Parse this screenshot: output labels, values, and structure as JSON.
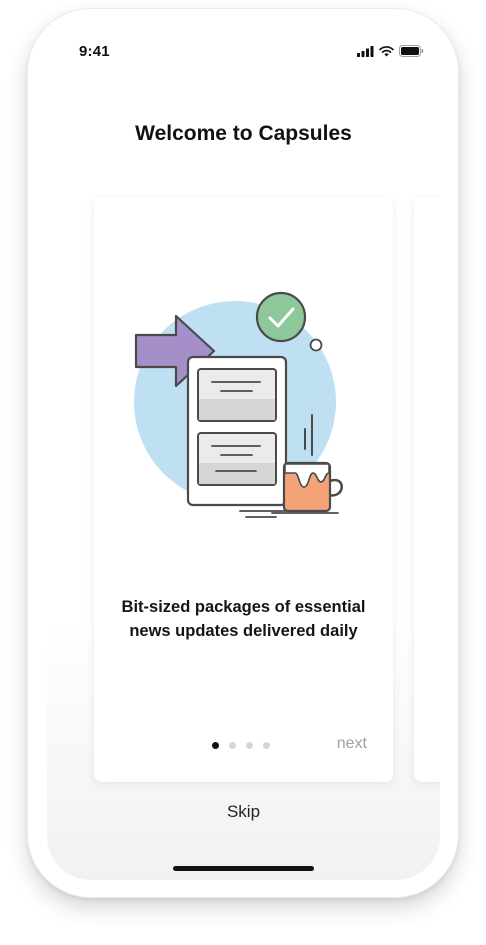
{
  "status_bar": {
    "time": "9:41",
    "icons": [
      "signal-icon",
      "wifi-icon",
      "battery-icon"
    ]
  },
  "onboarding": {
    "title": "Welcome to Capsules",
    "card": {
      "illustration": "news-capsule-illustration",
      "description": "Bit-sized packages of essential news updates delivered daily"
    },
    "pager": {
      "total": 4,
      "current": 1
    },
    "next_label": "next",
    "skip_label": "Skip"
  },
  "colors": {
    "background_circle": "#bfe0f3",
    "arrow": "#a58fc8",
    "check_badge": "#8ec79a",
    "mug": "#f4a278",
    "outline": "#4a4a4a",
    "next_text": "#a0a0a0"
  }
}
